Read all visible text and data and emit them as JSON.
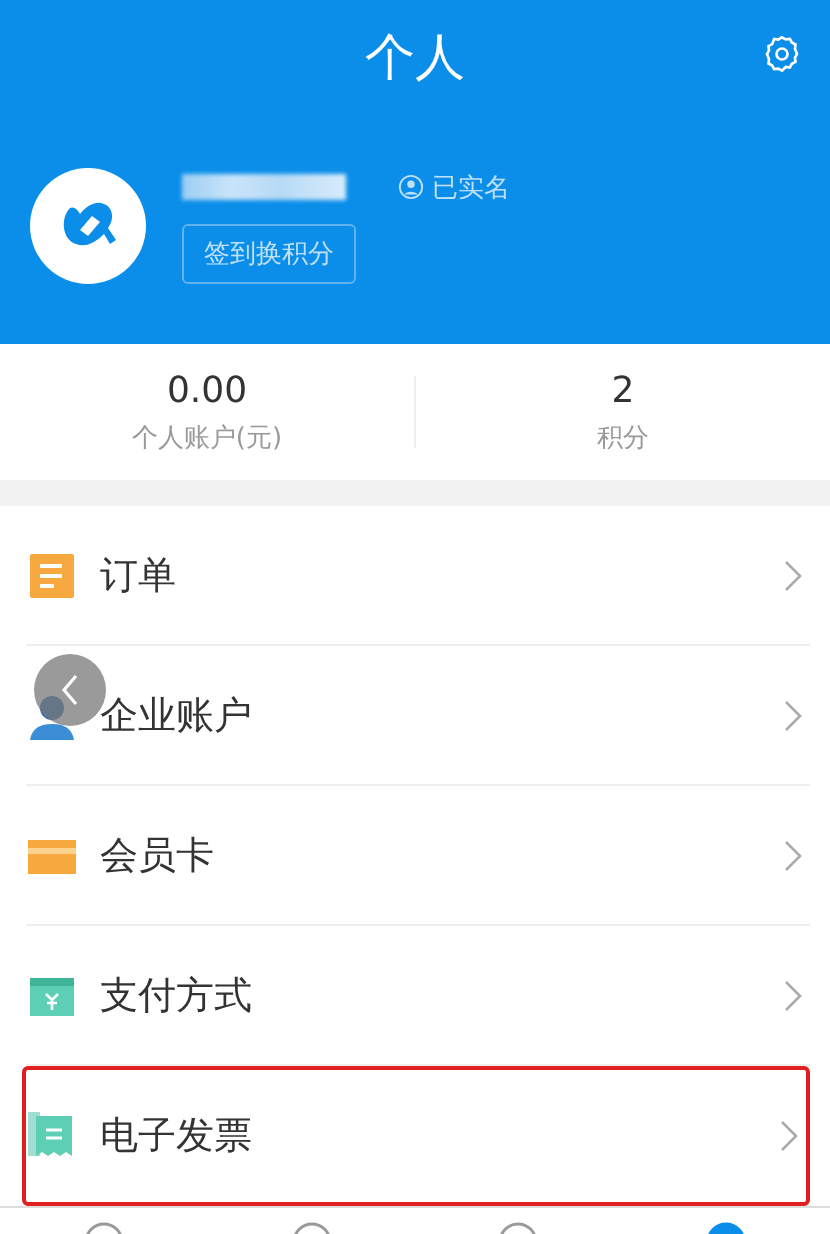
{
  "header": {
    "title": "个人"
  },
  "profile": {
    "verified_label": "已实名",
    "checkin_button": "签到换积分"
  },
  "stats": [
    {
      "value": "0.00",
      "label": "个人账户(元)"
    },
    {
      "value": "2",
      "label": "积分"
    }
  ],
  "menu": [
    {
      "kind": "order",
      "label": "订单",
      "highlighted": false
    },
    {
      "kind": "enterprise",
      "label": "企业账户",
      "highlighted": false
    },
    {
      "kind": "card",
      "label": "会员卡",
      "highlighted": false
    },
    {
      "kind": "payment",
      "label": "支付方式",
      "highlighted": false
    },
    {
      "kind": "invoice",
      "label": "电子发票",
      "highlighted": true
    }
  ],
  "bottom_nav": [
    {
      "selected": false
    },
    {
      "selected": false
    },
    {
      "selected": false
    },
    {
      "selected": true
    }
  ]
}
